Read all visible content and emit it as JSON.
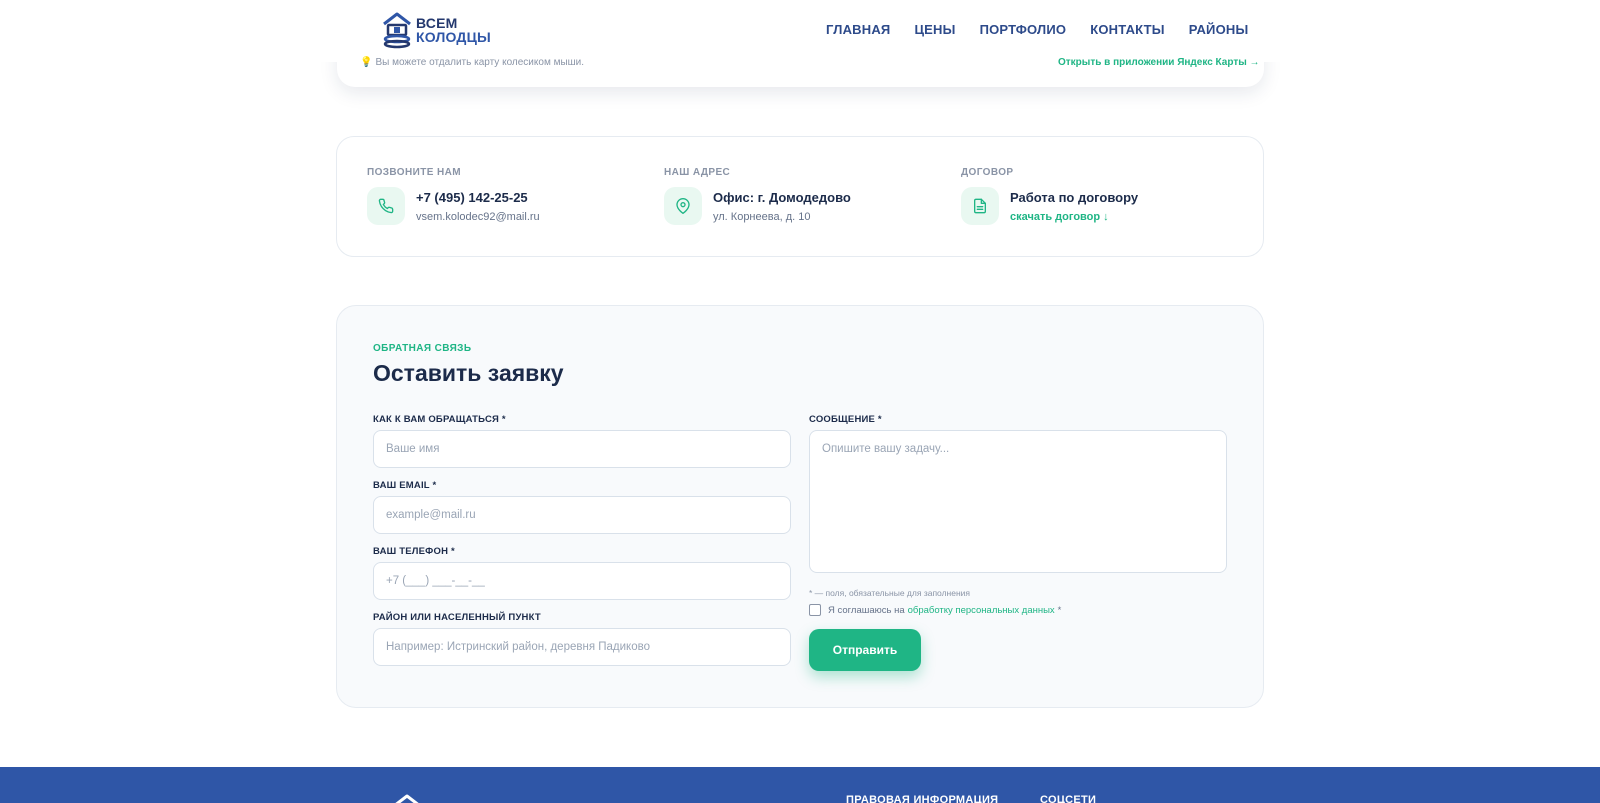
{
  "header": {
    "logo_line1": "ВСЕМ",
    "logo_line2": "КОЛОДЦЫ",
    "nav": [
      "ГЛАВНАЯ",
      "ЦЕНЫ",
      "ПОРТФОЛИО",
      "КОНТАКТЫ",
      "РАЙОНЫ"
    ]
  },
  "map": {
    "hint": "Вы можете отдалить карту колесиком мыши.",
    "open_link": "Открыть в приложении Яндекс Карты →"
  },
  "contacts": {
    "phone": {
      "label": "ПОЗВОНИТЕ НАМ",
      "main": "+7 (495) 142-25-25",
      "sub": "vsem.kolodec92@mail.ru",
      "icon": "phone-icon"
    },
    "address": {
      "label": "НАШ АДРЕС",
      "main": "Офис: г. Домодедово",
      "sub": "ул. Корнеева, д. 10",
      "icon": "map-pin-icon"
    },
    "contract": {
      "label": "ДОГОВОР",
      "main": "Работа по договору",
      "sub": "скачать договор ↓",
      "icon": "document-icon"
    }
  },
  "form": {
    "kicker": "ОБРАТНАЯ СВЯЗЬ",
    "title": "Оставить заявку",
    "name": {
      "label": "КАК К ВАМ ОБРАЩАТЬСЯ *",
      "placeholder": "Ваше имя"
    },
    "email": {
      "label": "ВАШ EMAIL *",
      "placeholder": "example@mail.ru"
    },
    "phone": {
      "label": "ВАШ ТЕЛЕФОН *",
      "placeholder": "+7 (___) ___-__-__"
    },
    "district": {
      "label": "РАЙОН ИЛИ НАСЕЛЕННЫЙ ПУНКТ",
      "placeholder": "Например: Истринский район, деревня Падиково"
    },
    "message": {
      "label": "СООБЩЕНИЕ *",
      "placeholder": "Опишите вашу задачу..."
    },
    "required_note": "* — поля, обязательные для заполнения",
    "agree_prefix": "Я соглашаюсь на",
    "agree_link": "обработку персональных данных",
    "agree_suffix": "*",
    "submit": "Отправить"
  },
  "footer": {
    "col1": "ПРАВОВАЯ ИНФОРМАЦИЯ",
    "col2": "СОЦСЕТИ"
  },
  "colors": {
    "accent": "#1fb585",
    "brand": "#2f56a7",
    "text": "#1c2b4a"
  }
}
